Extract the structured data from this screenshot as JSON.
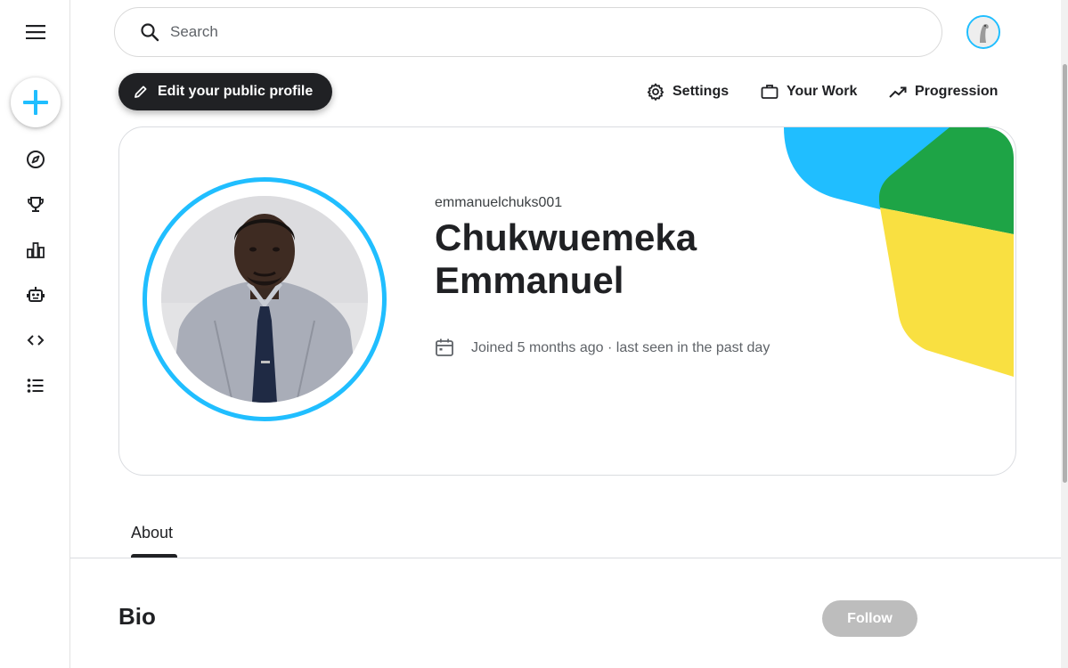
{
  "sidebar": {
    "menu_icon": "menu-icon",
    "create_icon": "plus-icon",
    "items": [
      {
        "id": "explore",
        "icon": "compass-icon"
      },
      {
        "id": "competitions",
        "icon": "trophy-icon"
      },
      {
        "id": "datasets",
        "icon": "bar-chart-icon"
      },
      {
        "id": "models",
        "icon": "robot-icon"
      },
      {
        "id": "code",
        "icon": "code-icon"
      },
      {
        "id": "discussions",
        "icon": "list-icon"
      }
    ]
  },
  "search": {
    "placeholder": "Search",
    "value": ""
  },
  "actions": {
    "edit_profile": "Edit your public profile",
    "settings": "Settings",
    "your_work": "Your Work",
    "progression": "Progression"
  },
  "profile": {
    "username": "emmanuelchuks001",
    "full_name": "Chukwuemeka Emmanuel",
    "joined": "Joined 5 months ago · last seen in the past day"
  },
  "tabs": [
    {
      "label": "About",
      "active": true
    }
  ],
  "bio": {
    "title": "Bio",
    "follow_label": "Follow"
  },
  "colors": {
    "accent_blue": "#20beff",
    "deco_green": "#1ea446",
    "deco_yellow": "#f9e041",
    "dark_button": "#202124",
    "follow_disabled": "#bdbdbd"
  }
}
